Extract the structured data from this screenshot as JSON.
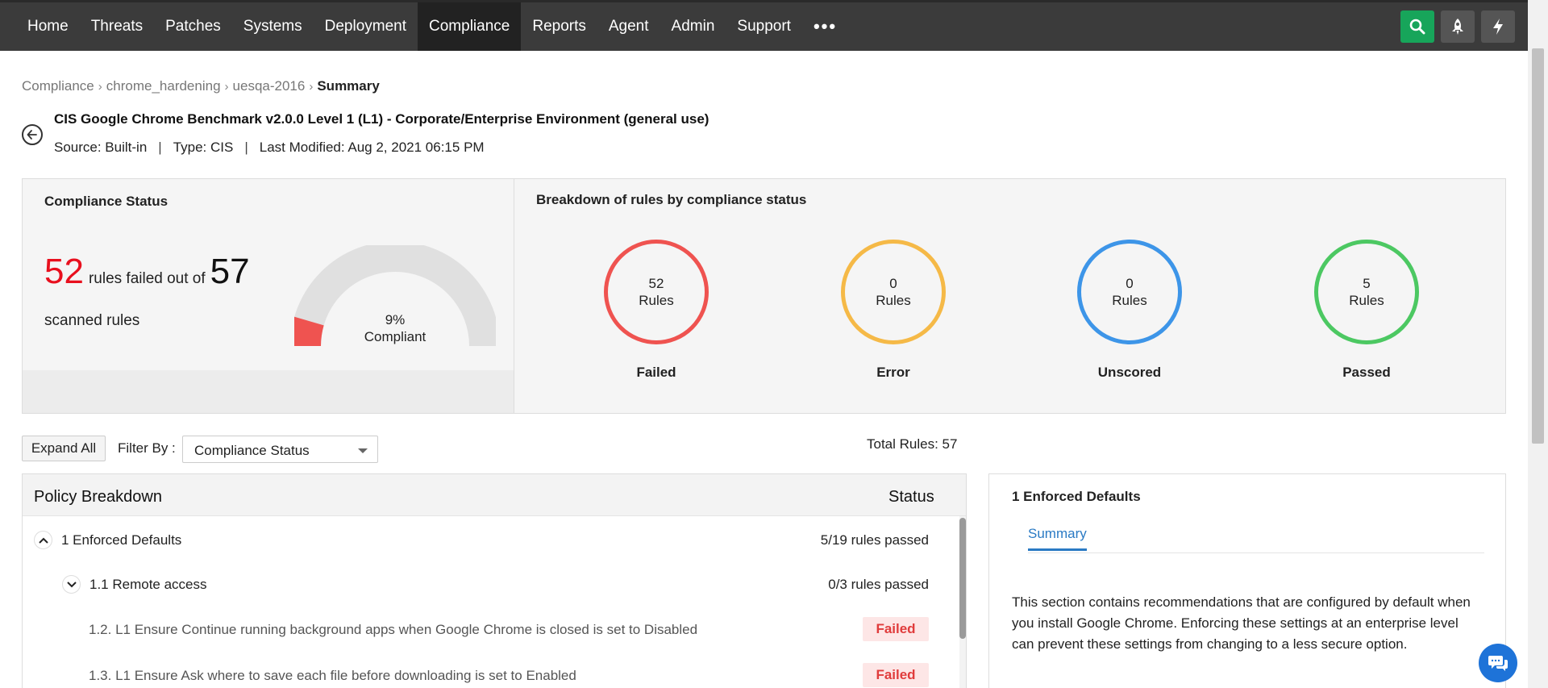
{
  "nav": {
    "items": [
      "Home",
      "Threats",
      "Patches",
      "Systems",
      "Deployment",
      "Compliance",
      "Reports",
      "Agent",
      "Admin",
      "Support"
    ],
    "active": "Compliance",
    "more": "•••"
  },
  "icons": {
    "search": "search-icon",
    "rocket": "rocket-icon",
    "lightning": "lightning-icon",
    "back": "arrow-left-icon",
    "chat": "chat-icon"
  },
  "colors": {
    "failed": "#ef5350",
    "error": "#f5b947",
    "unscored": "#3d95e8",
    "passed": "#4cc862",
    "accent_green": "#17a55a"
  },
  "breadcrumb": [
    "Compliance",
    "chrome_hardening",
    "uesqa-2016",
    "Summary"
  ],
  "header": {
    "title": "CIS Google Chrome Benchmark v2.0.0 Level 1 (L1) - Corporate/Enterprise Environment (general use)",
    "source": "Source: Built-in",
    "type": "Type: CIS",
    "modified": "Last Modified: Aug 2, 2021 06:15 PM",
    "pipe": "|"
  },
  "compliance_status": {
    "title": "Compliance Status",
    "failed_count": "52",
    "failed_text": "rules failed out of",
    "total": "57",
    "scanned_text": "scanned rules",
    "percent": "9%",
    "percent_label": "Compliant",
    "compliant_fraction": 0.09
  },
  "breakdown": {
    "title": "Breakdown of rules by compliance status",
    "items": [
      {
        "count": "52",
        "unit": "Rules",
        "label": "Failed"
      },
      {
        "count": "0",
        "unit": "Rules",
        "label": "Error"
      },
      {
        "count": "0",
        "unit": "Rules",
        "label": "Unscored"
      },
      {
        "count": "5",
        "unit": "Rules",
        "label": "Passed"
      }
    ]
  },
  "toolbar": {
    "expand_all": "Expand All",
    "filter_label": "Filter By :",
    "filter_value": "Compliance Status",
    "total_rules": "Total Rules: 57"
  },
  "policy": {
    "header_title": "Policy Breakdown",
    "header_status": "Status",
    "rows": [
      {
        "label": "1 Enforced Defaults",
        "status": "5/19 rules passed"
      },
      {
        "label": "1.1 Remote access",
        "status": "0/3 rules passed"
      },
      {
        "label": "1.2. L1 Ensure Continue running background apps when Google Chrome is closed is set to Disabled",
        "status": "Failed"
      },
      {
        "label": "1.3. L1 Ensure Ask where to save each file before downloading is set to Enabled",
        "status": "Failed"
      }
    ]
  },
  "side_panel": {
    "title": "1 Enforced Defaults",
    "tab": "Summary",
    "text": "This section contains recommendations that are configured by default when you install Google Chrome. Enforcing these settings at an enterprise level can prevent these settings from changing to a less secure option."
  }
}
